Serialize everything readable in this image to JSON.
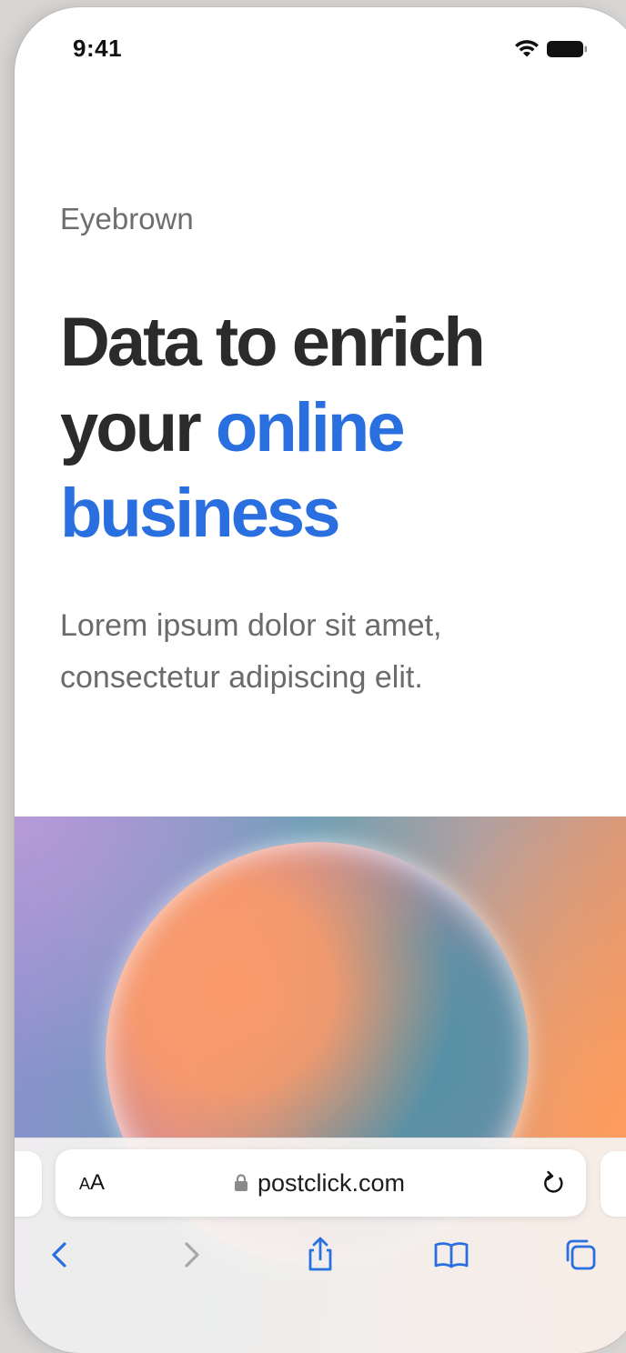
{
  "status_bar": {
    "time": "9:41"
  },
  "hero": {
    "eyebrow": "Eyebrown",
    "headline_line1": "Data to enrich",
    "headline_line2_dark": "your",
    "headline_line2_accent": "online",
    "headline_line3_accent": "business",
    "subtext": "Lorem ipsum dolor sit amet, consectetur adipiscing elit."
  },
  "browser": {
    "text_size_label_small": "A",
    "text_size_label_large": "A",
    "url": "postclick.com",
    "icons": {
      "back": "chevron-left-icon",
      "forward": "chevron-right-icon",
      "share": "share-icon",
      "bookmarks": "book-icon",
      "tabs": "tabs-icon",
      "reload": "reload-icon",
      "lock": "lock-icon"
    }
  },
  "colors": {
    "accent": "#2a6fe0",
    "headline": "#2b2b2b",
    "muted_text": "#6b6b6b"
  }
}
